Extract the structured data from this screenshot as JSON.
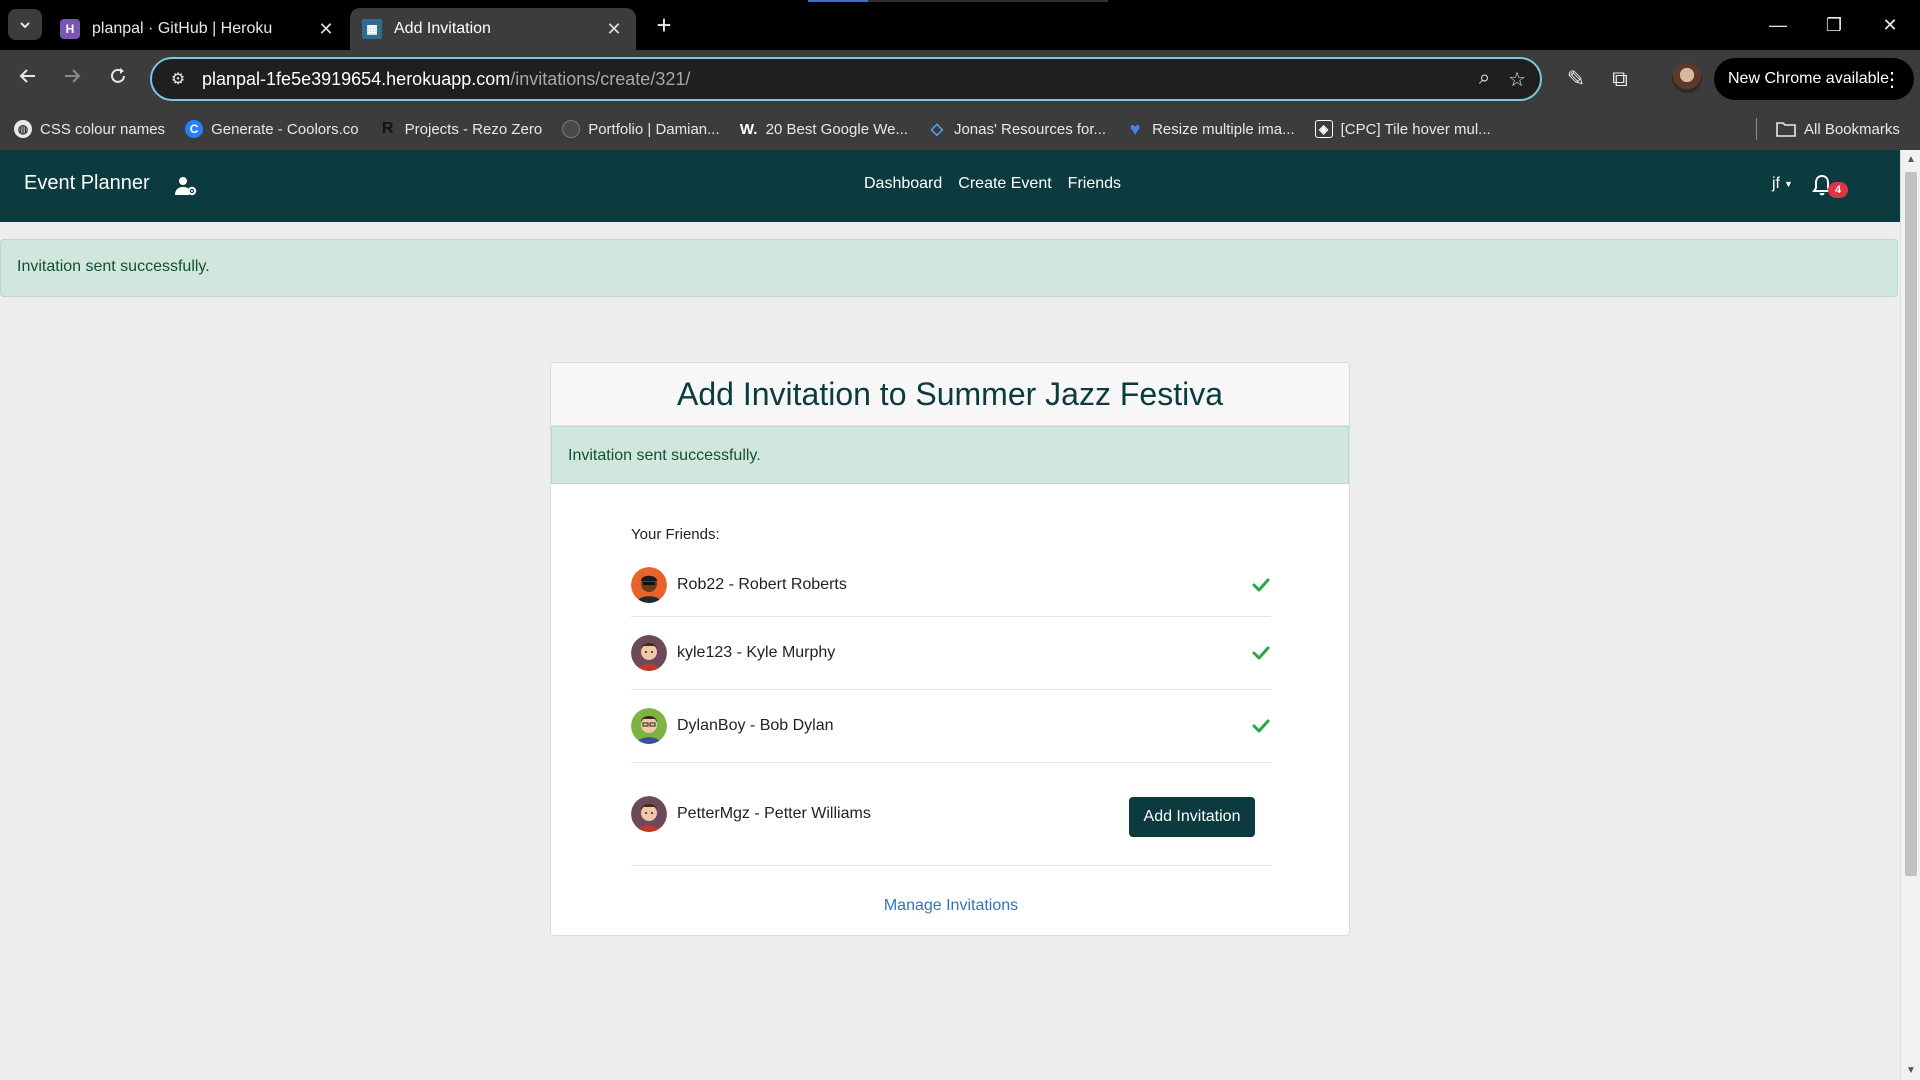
{
  "browser": {
    "tabs": [
      {
        "title": "planpal · GitHub | Heroku",
        "active": false,
        "favicon": "heroku-icon"
      },
      {
        "title": "Add Invitation",
        "active": true,
        "favicon": "event-planner-favicon"
      }
    ],
    "url_host": "planpal-1fe5e3919654.herokuapp.com",
    "url_path": "/invitations/create/321/",
    "update_label": "New Chrome available",
    "bookmarks": [
      {
        "label": "CSS colour names",
        "icon": "globe-icon"
      },
      {
        "label": "Generate - Coolors.co",
        "icon": "coolors-icon"
      },
      {
        "label": "Projects - Rezo Zero",
        "icon": "rezo-icon"
      },
      {
        "label": "Portfolio | Damian...",
        "icon": "portfolio-icon"
      },
      {
        "label": "20 Best Google We...",
        "icon": "w-icon"
      },
      {
        "label": "Jonas' Resources for...",
        "icon": "diamond-icon"
      },
      {
        "label": "Resize multiple ima...",
        "icon": "heart-icon"
      },
      {
        "label": "[CPC] Tile hover mul...",
        "icon": "codepen-icon"
      }
    ],
    "all_bookmarks_label": "All Bookmarks"
  },
  "nav": {
    "brand": "Event Planner",
    "links": [
      "Dashboard",
      "Create Event",
      "Friends"
    ],
    "user": "jf",
    "notification_count": "4"
  },
  "alert_top": "Invitation sent successfully.",
  "card": {
    "title": "Add Invitation to Summer Jazz Festiva",
    "alert": "Invitation sent successfully.",
    "friends_label": "Your Friends:",
    "friends": [
      {
        "name": "Rob22 - Robert Roberts",
        "invited": true
      },
      {
        "name": "kyle123 - Kyle Murphy",
        "invited": true
      },
      {
        "name": "DylanBoy - Bob Dylan",
        "invited": true
      },
      {
        "name": "PetterMgz - Petter Williams",
        "invited": false
      }
    ],
    "add_button": "Add Invitation",
    "manage_link": "Manage Invitations"
  },
  "colors": {
    "navbar": "#0b3b3f",
    "success_bg": "#d1e7dd",
    "check": "#28a745",
    "link": "#2f74c6",
    "badge": "#dc3545"
  }
}
